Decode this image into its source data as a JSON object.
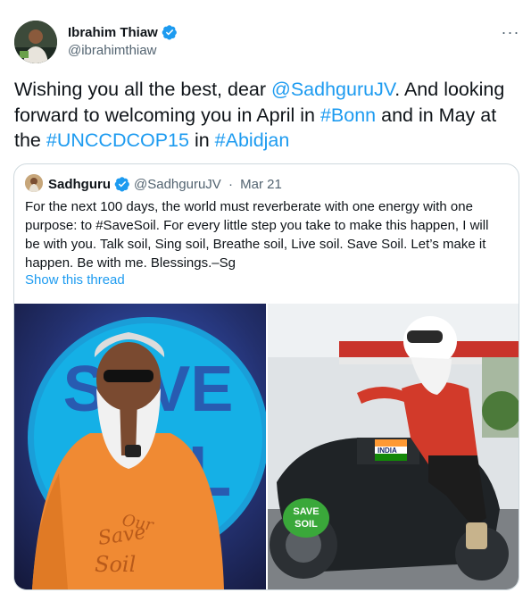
{
  "author": {
    "name": "Ibrahim Thiaw",
    "handle": "@ibrahimthiaw",
    "verified_color": "#1d9bf0"
  },
  "more_icon": "···",
  "tweet": {
    "t1": "Wishing you all the best, dear ",
    "mention": "@SadhguruJV",
    "t2": ". And looking forward to welcoming you in April in ",
    "tag_bonn": "#Bonn",
    "t3": " and in May at the ",
    "tag_cop": "#UNCCDCOP15",
    "t4": " in ",
    "tag_abidjan": "#Abidjan"
  },
  "quote": {
    "name": "Sadhguru",
    "handle": "@SadhguruJV",
    "dot": " · ",
    "date": "Mar 21",
    "text": "For the next 100 days, the world must reverberate with one energy with one purpose: to #SaveSoil. For every little step you take to make this happen, I will be with you. Talk soil, Sing soil, Breathe soil, Live soil. Save Soil. Let’s make it happen. Be with me. Blessings.–Sg",
    "show_thread": "Show this thread"
  },
  "media": {
    "left_sign": "SAVE SOIL",
    "shirt_text": "Save Our Soil",
    "right_badge": "SAVE SOIL",
    "flag_text": "INDIA"
  },
  "colors": {
    "link": "#1d9bf0",
    "text": "#0f1419",
    "muted": "#536471",
    "border": "#cfd9de"
  }
}
